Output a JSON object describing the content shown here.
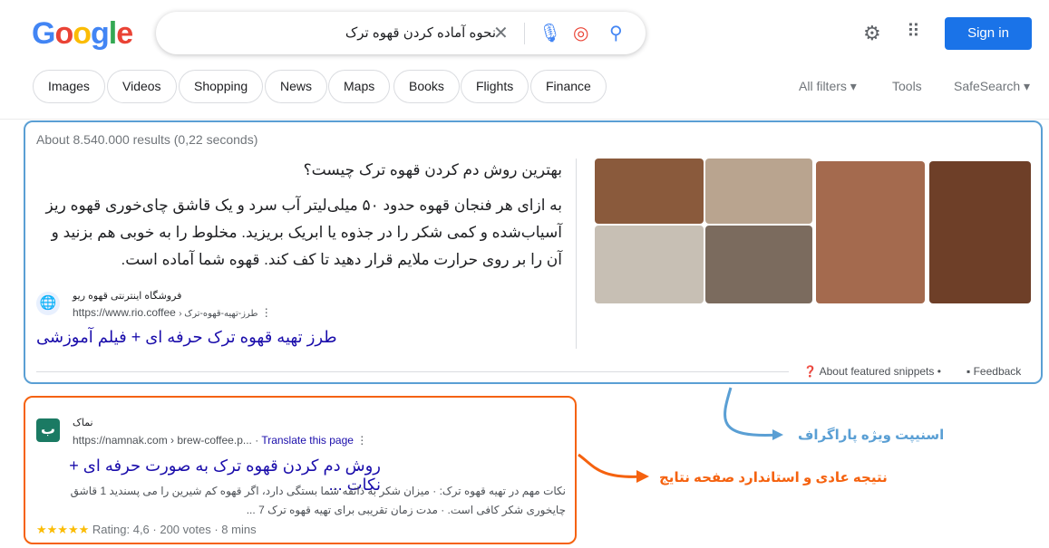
{
  "header": {
    "logo": "Google",
    "query": "نحوه آماده کردن قهوه ترک",
    "sign_in": "Sign in"
  },
  "tabs": [
    "Images",
    "Videos",
    "Shopping",
    "News",
    "Maps",
    "Books",
    "Flights",
    "Finance"
  ],
  "filters": {
    "all_filters": "All filters",
    "tools": "Tools",
    "safesearch": "SafeSearch"
  },
  "stats": "About 8.540.000 results (0,22 seconds)",
  "featured": {
    "question": "بهترین روش دم کردن قهوه ترک چیست؟",
    "paragraph": "به ازای هر فنجان قهوه حدود ۵۰ میلی‌لیتر آب سرد و یک قاشق چای‌خوری قهوه ریز آسیاب‌شده و کمی شکر را در جذوه یا ابریک بریزید. مخلوط را به خوبی هم بزنید و آن را بر روی حرارت ملایم قرار دهید تا کف کند. قهوه شما آماده است.",
    "site_name": "فروشگاه اینترنتی قهوه ریو",
    "url": "https://www.rio.coffee",
    "url_path": "› طرز-تهیه-قهوه-ترک",
    "title": "طرز تهیه قهوه ترک حرفه ای + فیلم آموزشی",
    "about": "About featured snippets",
    "feedback": "Feedback"
  },
  "result": {
    "site_name": "نماک",
    "url": "https://namnak.com › brew-coffee.p...",
    "translate": "Translate this page",
    "title": "روش دم کردن قهوه ترک به صورت حرفه ای + نکات ...",
    "snippet": "نکات مهم در تهیه قهوه ترک: · میزان شکر به ذائقه شما بستگی دارد، اگر قهوه کم شیرین را می پسندید 1 قاشق چایخوری شکر کافی است. · مدت زمان تقریبی برای تهیه قهوه ترک 7 ...",
    "rating": "Rating: 4,6",
    "votes": "200 votes",
    "time": "8 mins",
    "stars": 4.6
  },
  "annotations": {
    "snippet": "اسنیپت ویژه پاراگراف",
    "organic": "نتیجه عادی و استاندارد صفحه نتایج",
    "snippet_color": "#5a9fd4",
    "organic_color": "#f5620f"
  }
}
